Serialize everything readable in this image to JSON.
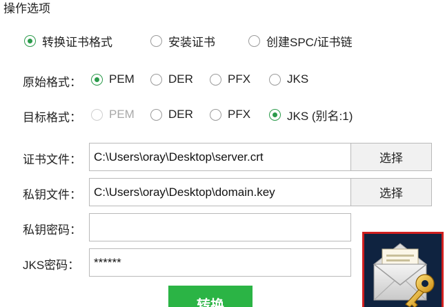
{
  "section_title": "操作选项",
  "operation": {
    "options": [
      {
        "label": "转换证书格式",
        "checked": true
      },
      {
        "label": "安装证书",
        "checked": false
      },
      {
        "label": "创建SPC/证书链",
        "checked": false
      }
    ]
  },
  "source_format": {
    "label": "原始格式：",
    "options": [
      {
        "label": "PEM",
        "checked": true
      },
      {
        "label": "DER",
        "checked": false
      },
      {
        "label": "PFX",
        "checked": false
      },
      {
        "label": "JKS",
        "checked": false
      }
    ]
  },
  "target_format": {
    "label": "目标格式：",
    "options": [
      {
        "label": "PEM",
        "checked": false,
        "disabled": true
      },
      {
        "label": "DER",
        "checked": false
      },
      {
        "label": "PFX",
        "checked": false
      },
      {
        "label": "JKS (别名:1)",
        "checked": true
      }
    ]
  },
  "cert_file": {
    "label": "证书文件：",
    "value": "C:\\Users\\oray\\Desktop\\server.crt",
    "button": "选择"
  },
  "key_file": {
    "label": "私钥文件：",
    "value": "C:\\Users\\oray\\Desktop\\domain.key",
    "button": "选择"
  },
  "key_password": {
    "label": "私钥密码：",
    "value": ""
  },
  "jks_password": {
    "label": "JKS密码：",
    "value": "******"
  },
  "convert_button": "转换",
  "colors": {
    "accent": "#2bb445",
    "radio_checked": "#2a9a4a",
    "icon_frame": "#d01f1f"
  },
  "icons": {
    "app": "certificate-envelope-key-icon"
  }
}
